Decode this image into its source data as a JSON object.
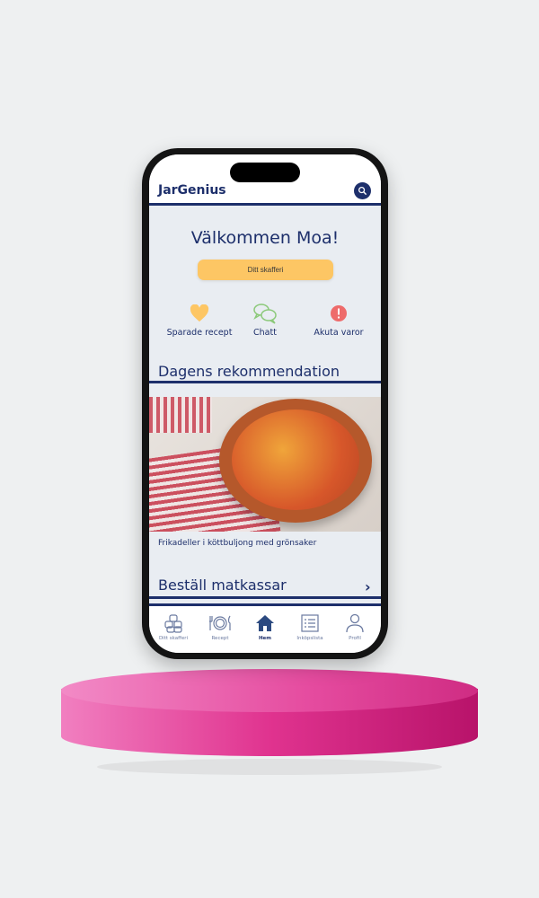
{
  "header": {
    "logo": "JarGenius"
  },
  "home": {
    "welcome": "Välkommen Moa!",
    "pantry_button": "Ditt skafferi",
    "quick_actions": [
      {
        "label": "Sparade recept",
        "icon": "heart-icon"
      },
      {
        "label": "Chatt",
        "icon": "chat-icon"
      },
      {
        "label": "Akuta varor",
        "icon": "alert-icon"
      }
    ],
    "recommendation_title": "Dagens rekommendation",
    "recipe_caption": "Frikadeller i köttbuljong med grönsaker",
    "order_title": "Beställ matkassar"
  },
  "tabs": [
    {
      "label": "Ditt skafferi"
    },
    {
      "label": "Recept"
    },
    {
      "label": "Hem"
    },
    {
      "label": "Inköpslista"
    },
    {
      "label": "Profil"
    }
  ],
  "colors": {
    "primary": "#1d2f6b",
    "accent": "#fdc664",
    "chat": "#8cc97a",
    "alert": "#ee6b6b",
    "pedestal": "#e54b9f"
  }
}
